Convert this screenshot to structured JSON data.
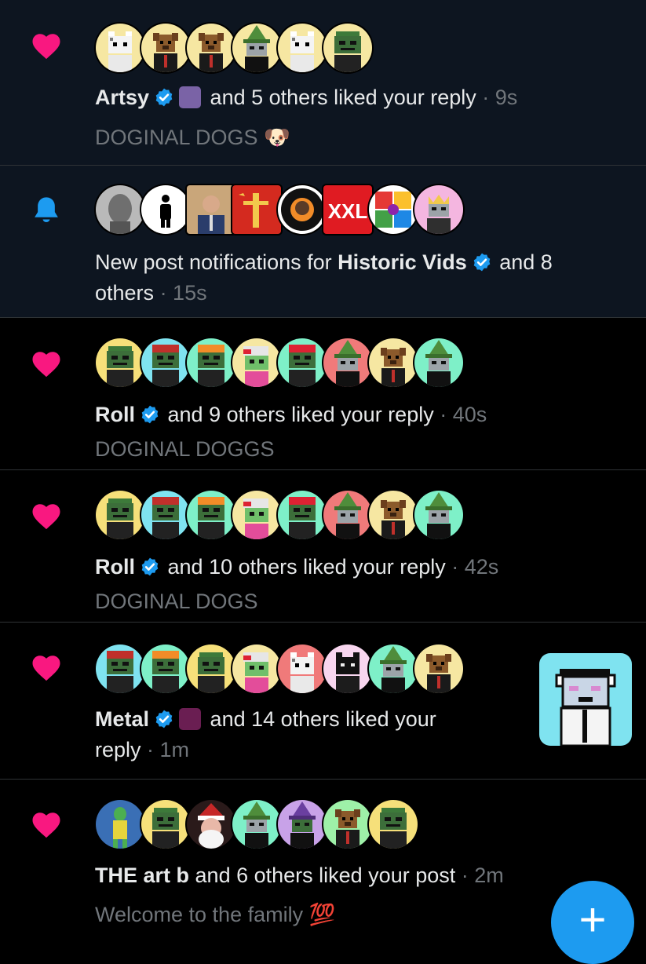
{
  "colors": {
    "like": "#f91880",
    "bell": "#1d9bf0",
    "verified": "#1d9bf0",
    "muted": "#71767b",
    "text": "#e7e9ea",
    "fab": "#1d9bf0"
  },
  "notifications": [
    {
      "type": "like",
      "icon": "heart-icon",
      "actor": "Artsy",
      "text": "and 5 others liked your reply",
      "time": "· 9s",
      "snippet": "DOGINAL DOGS 🐶"
    },
    {
      "type": "new-posts",
      "icon": "bell-icon",
      "text_prefix": "New post notifications for",
      "actor": "Historic Vids",
      "text_suffix": "and 8",
      "text_line2": "others",
      "time": "· 15s",
      "avatar_labels": [
        "XXL"
      ]
    },
    {
      "type": "like",
      "icon": "heart-icon",
      "actor": "Roll",
      "text": "and 9 others liked your reply",
      "time": "· 40s",
      "snippet": "DOGINAL DOGGS"
    },
    {
      "type": "like",
      "icon": "heart-icon",
      "actor": "Roll",
      "text": "and 10 others liked your reply",
      "time": "· 42s",
      "snippet": "DOGINAL DOGS"
    },
    {
      "type": "like",
      "icon": "heart-icon",
      "actor": "Metal",
      "text": "and 14 others liked your",
      "text_line2": "reply",
      "time": "· 1m"
    },
    {
      "type": "like",
      "icon": "heart-icon",
      "actor": "THE art b",
      "text": "and 6 others liked your post",
      "time": "· 2m",
      "snippet": "Welcome to the family 💯"
    }
  ],
  "fab": {
    "label": "+",
    "icon": "compose-plus-icon"
  }
}
